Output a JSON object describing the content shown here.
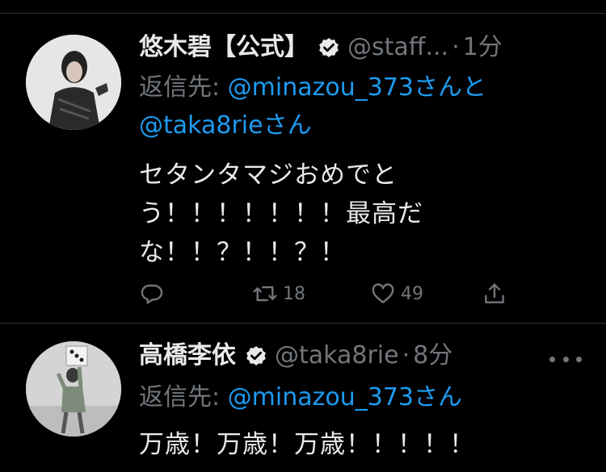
{
  "tweets": [
    {
      "name": "悠木碧【公式】",
      "handle": "@staff...",
      "dot": "·",
      "time": "1分",
      "reply_prefix": "返信先: ",
      "reply_mention_1": "@minazou_373",
      "reply_mid": "さんと",
      "reply_mention_2": "@taka8rie",
      "reply_suffix": "さん",
      "text_lines": [
        "セタンタマジおめでと",
        "う！！！！！！！最高だ",
        "な！！？！！？！"
      ],
      "actions": {
        "replies": "",
        "retweets": "18",
        "likes": "49"
      }
    },
    {
      "name": "高橋李依",
      "handle": "@taka8rie",
      "dot": "·",
      "time": "8分",
      "reply_prefix": "返信先: ",
      "reply_mention_1": "@minazou_373",
      "reply_suffix": "さん",
      "text": "万歳！万歳！万歳！！！！！"
    }
  ],
  "colors": {
    "background": "#000000",
    "text_primary": "#e7e9ea",
    "text_secondary": "#71767b",
    "link": "#1d9bf0",
    "divider": "#2f3336"
  },
  "icons": {
    "verified": "verified-badge-icon",
    "reply": "reply-bubble-icon",
    "retweet": "retweet-arrows-icon",
    "like": "heart-outline-icon",
    "share": "share-upload-icon",
    "more": "more-dots-icon"
  }
}
